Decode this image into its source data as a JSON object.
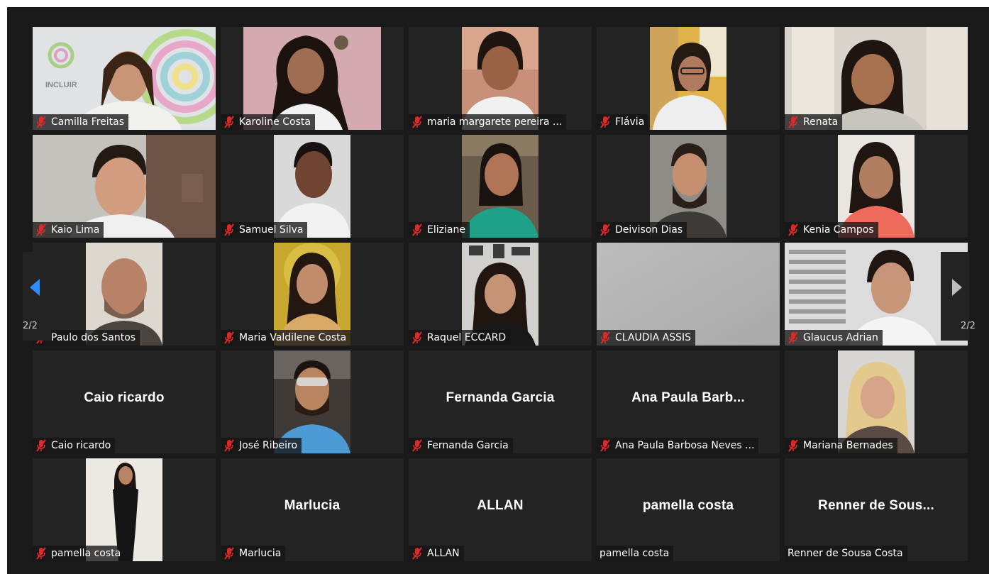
{
  "accent_color": "#2d8cff",
  "muted_mic_color": "#e02828",
  "pagination": {
    "left_page": "2/2",
    "right_page": "2/2"
  },
  "participants": [
    {
      "name": "Camilla Freitas",
      "video": true,
      "muted": true,
      "logo_text": "INCLUIR"
    },
    {
      "name": "Karoline Costa",
      "video": true,
      "muted": true
    },
    {
      "name": "maria margarete pereira ...",
      "video": true,
      "muted": true
    },
    {
      "name": "Flávia",
      "video": true,
      "muted": true
    },
    {
      "name": "Renata",
      "video": true,
      "muted": true
    },
    {
      "name": "Kaio Lima",
      "video": true,
      "muted": true
    },
    {
      "name": "Samuel Silva",
      "video": true,
      "muted": true
    },
    {
      "name": "Eliziane",
      "video": true,
      "muted": true
    },
    {
      "name": "Deivison Dias",
      "video": true,
      "muted": true
    },
    {
      "name": "Kenia Campos",
      "video": true,
      "muted": true
    },
    {
      "name": "Paulo dos Santos",
      "video": true,
      "muted": true
    },
    {
      "name": "Maria Valdilene Costa",
      "video": true,
      "muted": true
    },
    {
      "name": "Raquel ECCARD",
      "video": true,
      "muted": true
    },
    {
      "name": "CLAUDIA ASSIS",
      "video": true,
      "muted": true
    },
    {
      "name": "Glaucus Adrian",
      "video": true,
      "muted": true
    },
    {
      "name": "Caio ricardo",
      "video": false,
      "muted": true,
      "display_name": "Caio ricardo"
    },
    {
      "name": "José Ribeiro",
      "video": true,
      "muted": true
    },
    {
      "name": "Fernanda Garcia",
      "video": false,
      "muted": true,
      "display_name": "Fernanda Garcia"
    },
    {
      "name": "Ana Paula Barbosa Neves ...",
      "video": false,
      "muted": true,
      "display_name": "Ana Paula Barb..."
    },
    {
      "name": "Mariana Bernades",
      "video": true,
      "muted": true
    },
    {
      "name": "pamella costa",
      "video": true,
      "muted": true
    },
    {
      "name": "Marlucia",
      "video": false,
      "muted": true,
      "display_name": "Marlucia"
    },
    {
      "name": "ALLAN",
      "video": false,
      "muted": true,
      "display_name": "ALLAN"
    },
    {
      "name": "pamella costa",
      "video": false,
      "muted": false,
      "display_name": "pamella costa"
    },
    {
      "name": "Renner de Sousa Costa",
      "video": false,
      "muted": false,
      "display_name": "Renner de Sous..."
    }
  ]
}
